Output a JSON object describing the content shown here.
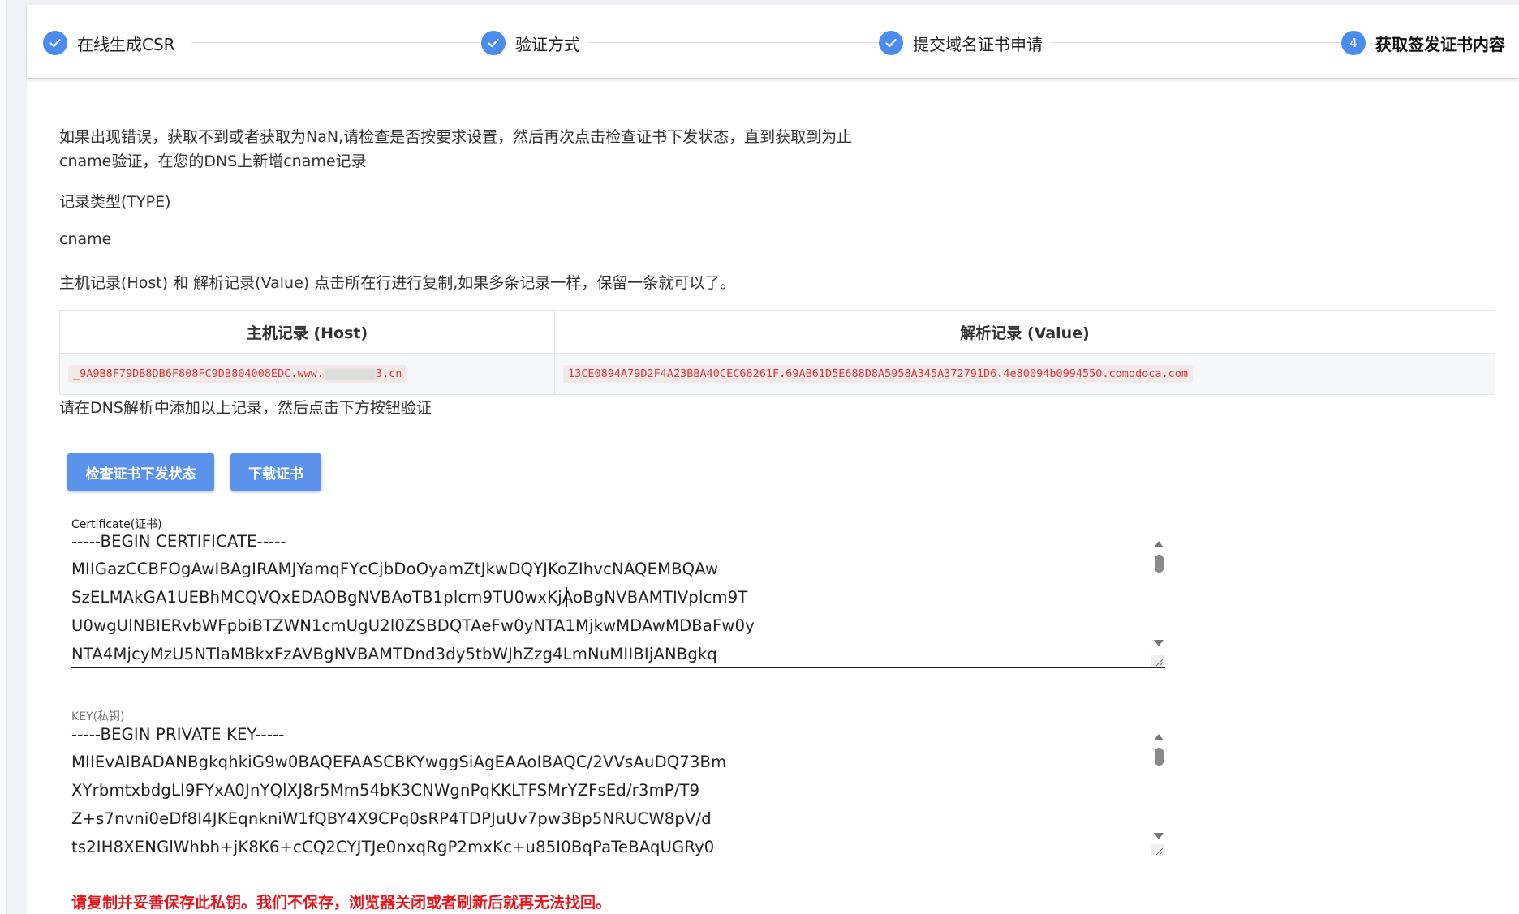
{
  "steps": [
    {
      "label": "在线生成CSR",
      "state": "done"
    },
    {
      "label": "验证方式",
      "state": "done"
    },
    {
      "label": "提交域名证书申请",
      "state": "done"
    },
    {
      "label": "获取签发证书内容",
      "state": "active",
      "number": "4"
    }
  ],
  "info": {
    "line1": "如果出现错误，获取不到或者获取为NaN,请检查是否按要求设置，然后再次点击检查证书下发状态，直到获取到为止",
    "line2": "cname验证，在您的DNS上新增cname记录",
    "type_label": "记录类型(TYPE)",
    "type_value": "cname",
    "copy_hint": "主机记录(Host) 和 解析记录(Value) 点击所在行进行复制,如果多条记录一样，保留一条就可以了。",
    "after_table": "请在DNS解析中添加以上记录，然后点击下方按钮验证"
  },
  "table": {
    "headers": {
      "host": "主机记录 (Host)",
      "value": "解析记录 (Value)"
    },
    "row": {
      "host_prefix": "_9A9B8F79DB8DB6F808FC9DB804008EDC.www.",
      "host_suffix": "3.cn",
      "value": "13CE0894A79D2F4A23BBA40CEC68261F.69AB61D5E688D8A5958A345A372791D6.4e80094b0994550.comodoca.com"
    }
  },
  "buttons": {
    "check": "检查证书下发状态",
    "download": "下载证书"
  },
  "certificate": {
    "label": "Certificate(证书)",
    "lines": [
      "-----BEGIN CERTIFICATE-----",
      "MIIGazCCBFOgAwIBAgIRAMJYamqFYcCjbDoOyamZtJkwDQYJKoZIhvcNAQEMBQAw",
      "SzELMAkGA1UEBhMCQVQxEDAOBgNVBAoTB1plcm9TU0wxKjAoBgNVBAMTIVplcm9T",
      "U0wgUlNBIERvbWFpbiBTZWN1cmUgU2l0ZSBDQTAeFw0yNTA1MjkwMDAwMDBaFw0y",
      "NTA4MjcyMzU5NTlaMBkxFzAVBgNVBAMTDnd3dy5tbWJhZzg4LmNuMIIBIjANBgkq"
    ]
  },
  "key": {
    "label": "KEY(私钥)",
    "lines": [
      "-----BEGIN PRIVATE KEY-----",
      "MIIEvAIBADANBgkqhkiG9w0BAQEFAASCBKYwggSiAgEAAoIBAQC/2VVsAuDQ73Bm",
      "XYrbmtxbdgLI9FYxA0JnYQlXJ8r5Mm54bK3CNWgnPqKKLTFSMrYZFsEd/r3mP/T9",
      "Z+s7nvni0eDf8I4JKEqnkniW1fQBY4X9CPq0sRP4TDPJuUv7pw3Bp5NRUCW8pV/d",
      "ts2IH8XENGlWhbh+jK8K6+cCQ2CYJTJe0nxqRgP2mxKc+u85I0BqPaTeBAqUGRy0"
    ]
  },
  "warning": "请复制并妥善保存此私钥。我们不保存，浏览器关闭或者刷新后就再无法找回。",
  "colors": {
    "accent": "#4a8cf0",
    "button": "#5b93ea",
    "code": "#e0353a",
    "warning": "#e8141b"
  }
}
